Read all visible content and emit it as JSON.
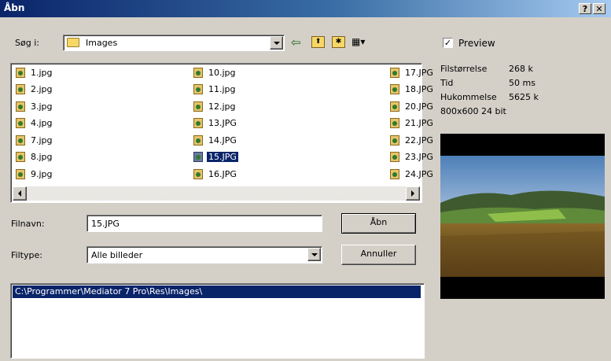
{
  "window": {
    "title": "Åbn",
    "help_glyph": "?",
    "close_glyph": "✕"
  },
  "lookin": {
    "label": "Søg i:",
    "value": "Images"
  },
  "toolbar": {
    "back_glyph": "⇦",
    "up_glyph": "⬆",
    "newfolder_glyph": "✱",
    "view_glyph": "▦▾"
  },
  "files": {
    "col1": [
      "1.jpg",
      "2.jpg",
      "3.jpg",
      "4.jpg",
      "7.jpg",
      "8.jpg",
      "9.jpg"
    ],
    "col2": [
      "10.jpg",
      "11.jpg",
      "12.jpg",
      "13.JPG",
      "14.JPG",
      "15.JPG",
      "16.JPG"
    ],
    "col3": [
      "17.JPG",
      "18.JPG",
      "20.JPG",
      "21.JPG",
      "22.JPG",
      "23.JPG",
      "24.JPG"
    ],
    "selected": "15.JPG"
  },
  "filename": {
    "label": "Filnavn:",
    "value": "15.JPG"
  },
  "filetype": {
    "label": "Filtype:",
    "value": "Alle billeder"
  },
  "buttons": {
    "open": "Åbn",
    "cancel": "Annuller"
  },
  "path": {
    "value": "C:\\Programmer\\Mediator 7 Pro\\Res\\Images\\"
  },
  "preview": {
    "check_label": "Preview",
    "checked": true,
    "rows": [
      {
        "label": "Filstørrelse",
        "value": "268 k"
      },
      {
        "label": "Tid",
        "value": "50 ms"
      },
      {
        "label": "Hukommelse",
        "value": "5625 k"
      }
    ],
    "dimensions": "800x600 24 bit"
  }
}
